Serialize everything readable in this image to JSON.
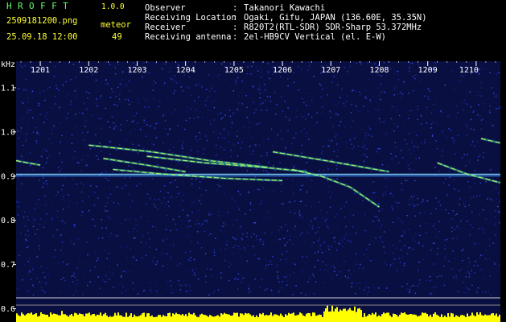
{
  "app": {
    "name": "HROFFT",
    "version": "1.0.0"
  },
  "file_name": "2509181200.png",
  "date_time": "25.09.18 12:00",
  "meteor": {
    "label": "meteor",
    "count": "49"
  },
  "info": [
    {
      "label": "Observer",
      "value": "Takanori Kawachi"
    },
    {
      "label": "Receiving Location",
      "value": "Ogaki, Gifu, JAPAN (136.60E, 35.35N)"
    },
    {
      "label": "Receiver",
      "value": "R820T2(RTL-SDR) SDR-Sharp 53.372MHz"
    },
    {
      "label": "Receiving antenna",
      "value": "2el-HB9CV Vertical (el. E-W)"
    }
  ],
  "separator": ":",
  "colors": {
    "header_green": "#66ff66",
    "header_yellow": "#ffff33",
    "text_white": "#ffffff",
    "background": "#000000",
    "noise_blue": "#1a2a9a",
    "histogram_yellow": "#ffff00"
  },
  "chart_data": {
    "type": "heatmap",
    "y_unit": "kHz",
    "x_ticks": [
      "1201",
      "1202",
      "1203",
      "1204",
      "1205",
      "1206",
      "1207",
      "1208",
      "1209",
      "1210"
    ],
    "y_ticks": [
      "1.1",
      "1.0",
      "0.9",
      "0.8",
      "0.7",
      "0.6"
    ],
    "xlim": [
      1200.5,
      1210.5
    ],
    "ylim": [
      0.57,
      1.16
    ],
    "constant_tones_khz": [
      0.904,
      0.9
    ],
    "meteor_trails": [
      {
        "points": [
          [
            1200.5,
            0.935
          ],
          [
            1201.0,
            0.925
          ]
        ]
      },
      {
        "points": [
          [
            1202.0,
            0.97
          ],
          [
            1203.3,
            0.955
          ],
          [
            1204.5,
            0.935
          ],
          [
            1205.7,
            0.92
          ]
        ]
      },
      {
        "points": [
          [
            1202.3,
            0.94
          ],
          [
            1203.2,
            0.925
          ],
          [
            1204.0,
            0.91
          ]
        ]
      },
      {
        "points": [
          [
            1203.2,
            0.945
          ],
          [
            1204.4,
            0.93
          ],
          [
            1205.6,
            0.92
          ],
          [
            1206.5,
            0.91
          ]
        ]
      },
      {
        "points": [
          [
            1206.2,
            0.915
          ],
          [
            1206.8,
            0.9
          ],
          [
            1207.4,
            0.875
          ],
          [
            1208.0,
            0.83
          ]
        ]
      },
      {
        "points": [
          [
            1205.8,
            0.955
          ],
          [
            1206.9,
            0.935
          ],
          [
            1208.2,
            0.91
          ]
        ]
      },
      {
        "points": [
          [
            1202.5,
            0.915
          ],
          [
            1203.5,
            0.905
          ],
          [
            1204.8,
            0.895
          ],
          [
            1206.0,
            0.89
          ]
        ]
      },
      {
        "points": [
          [
            1209.2,
            0.93
          ],
          [
            1209.8,
            0.905
          ],
          [
            1210.5,
            0.885
          ]
        ]
      },
      {
        "points": [
          [
            1210.1,
            0.985
          ],
          [
            1210.5,
            0.975
          ]
        ]
      }
    ]
  }
}
